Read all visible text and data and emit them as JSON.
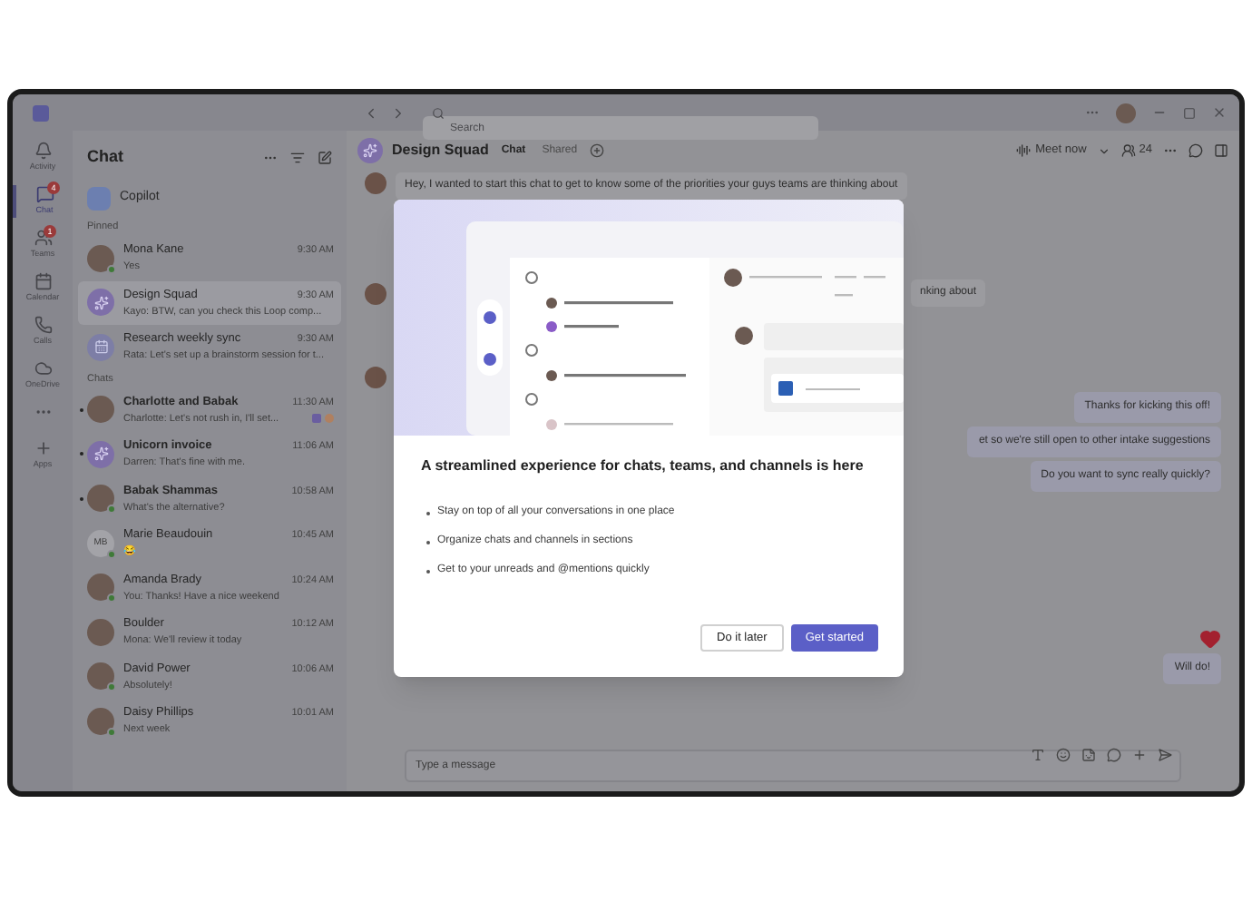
{
  "title_bar": {
    "search_placeholder": "Search"
  },
  "rail": [
    {
      "kind": "activity",
      "label": "Activity",
      "selected": false
    },
    {
      "kind": "chat",
      "label": "Chat",
      "selected": true,
      "badge": "4"
    },
    {
      "kind": "teams",
      "label": "Teams",
      "selected": false,
      "badge": "1"
    },
    {
      "kind": "calendar",
      "label": "Calendar",
      "selected": false
    },
    {
      "kind": "calls",
      "label": "Calls",
      "selected": false
    },
    {
      "kind": "onedrive",
      "label": "OneDrive",
      "selected": false
    },
    {
      "kind": "more",
      "selected": false
    },
    {
      "kind": "apps",
      "label": "Apps",
      "selected": false
    }
  ],
  "chat_list": {
    "title": "Chat",
    "copilot": "Copilot",
    "sections": [
      {
        "header": "Pinned",
        "items": [
          {
            "name": "Mona Kane",
            "preview": "Yes",
            "time": "9:30 AM",
            "kind": "photo",
            "online": true,
            "unread": false,
            "selected": false
          },
          {
            "name": "Design Squad",
            "preview": "Kayo: BTW, can you check this Loop comp...",
            "time": "9:30 AM",
            "kind": "group",
            "online": false,
            "unread": false,
            "selected": true
          },
          {
            "name": "Research weekly sync",
            "preview": "Rata: Let's set up a brainstorm session for t...",
            "time": "9:30 AM",
            "kind": "meeting",
            "online": false,
            "unread": false,
            "selected": false
          }
        ]
      },
      {
        "header": "Chats",
        "items": [
          {
            "name": "Charlotte and Babak",
            "preview": "Charlotte: Let's not rush in, I'll set...",
            "time": "11:30 AM",
            "kind": "photo",
            "online": false,
            "unread": true,
            "selected": false,
            "reactions": true
          },
          {
            "name": "Unicorn invoice",
            "preview": "Darren: That's fine with me.",
            "time": "11:06 AM",
            "kind": "group",
            "online": false,
            "unread": true,
            "selected": false
          },
          {
            "name": "Babak Shammas",
            "preview": "What's the alternative?",
            "time": "10:58 AM",
            "kind": "photo",
            "online": true,
            "unread": true,
            "selected": false
          },
          {
            "name": "Marie Beaudouin",
            "preview": "😂",
            "time": "10:45 AM",
            "kind": "initials",
            "initials": "MB",
            "online": true,
            "unread": false,
            "selected": false
          },
          {
            "name": "Amanda Brady",
            "preview": "You: Thanks! Have a nice weekend",
            "time": "10:24 AM",
            "kind": "photo",
            "online": true,
            "unread": false,
            "selected": false
          },
          {
            "name": "Boulder",
            "preview": "Mona: We'll review it today",
            "time": "10:12 AM",
            "kind": "photo",
            "online": false,
            "unread": false,
            "selected": false
          },
          {
            "name": "David Power",
            "preview": "Absolutely!",
            "time": "10:06 AM",
            "kind": "photo",
            "online": true,
            "unread": false,
            "selected": false
          },
          {
            "name": "Daisy Phillips",
            "preview": "Next week",
            "time": "10:01 AM",
            "kind": "photo",
            "online": true,
            "unread": false,
            "selected": false
          }
        ]
      }
    ]
  },
  "conversation": {
    "title": "Design Squad",
    "tabs": [
      {
        "label": "Chat",
        "selected": true
      },
      {
        "label": "Shared",
        "selected": false
      }
    ],
    "meet_now": "Meet now",
    "participants": "24",
    "messages": [
      {
        "kind": "other",
        "text": "Hey, I wanted to start this chat to get to know some of the priorities your guys teams are thinking about"
      },
      {
        "kind": "other_hidden",
        "text": "nking about"
      },
      {
        "kind": "other_avatar"
      },
      {
        "kind": "mine",
        "text": "Thanks for kicking this off!"
      },
      {
        "kind": "mine",
        "text": "et so we're still open to other intake suggestions"
      },
      {
        "kind": "mine",
        "text": "Do you want to sync really quickly?"
      },
      {
        "kind": "reaction"
      },
      {
        "kind": "mine",
        "text": "Will do!"
      }
    ],
    "compose_placeholder": "Type a message"
  },
  "dialog": {
    "title": "A streamlined experience for chats, teams, and channels is here",
    "bullets": [
      "Stay on top of all your conversations in one place",
      "Organize chats and channels in sections",
      "Get to your unreads and @mentions quickly"
    ],
    "buttons": [
      {
        "label": "Do it later",
        "primary": false
      },
      {
        "label": "Get started",
        "primary": true
      }
    ]
  }
}
